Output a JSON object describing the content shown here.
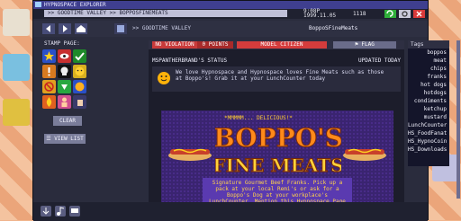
{
  "window": {
    "title": "HYPNOSPACE EXPLORER",
    "url": ">> GOODTIME VALLEY >> BOPPOSFINEMEATS",
    "clock": {
      "time": "9:08P",
      "date": "1999.11.05"
    },
    "credits": "1118",
    "path": ">> GOODTIME VALLEY",
    "page_title": "BoppoSFineMeats"
  },
  "stamp_panel": {
    "heading": "STAMP PAGE:",
    "clear_label": "CLEAR",
    "view_list_label": "VIEW LIST"
  },
  "banner": {
    "violation": "NO VIOLATION",
    "points": "0 POINTS",
    "model": "MODEL CITIZEN",
    "flag": "FLAG"
  },
  "status": {
    "heading": "MSPANTHERBRAND'S STATUS",
    "updated": "UPDATED TODAY",
    "text": "We love Hypnospace and Hypnospace loves Fine Meats such as those at Boppo's! Grab it at your LunchCounter today"
  },
  "ad": {
    "tagline": "*MMMMM... DELICIOUS!*",
    "logo_line1": "BOPPO'S",
    "logo_line2": "FINE MEATS",
    "body": "Signature Gourmet Beef Franks. Pick up a pack at your local Remi's or ask for a Boppo's Dog at your workplace's LunchCounter. Mention this Hypnospace Page and receive a free condiment packet!"
  },
  "tags": {
    "heading": "Tags",
    "items": [
      "boppos",
      "meat",
      "chips",
      "franks",
      "hot dogs",
      "hotdogs",
      "condiments",
      "ketchup",
      "mustard",
      "LunchCounter",
      "HS_FoodFanat",
      "HS_HypnoCoin",
      "HS_Downloads"
    ]
  },
  "colors": {
    "accent": "#3f3f8f",
    "violation_red": "#c83a3a",
    "citizen_red": "#d43c3c",
    "logo_orange": "#ff8a1a",
    "logo_yellow": "#ffd23a"
  }
}
